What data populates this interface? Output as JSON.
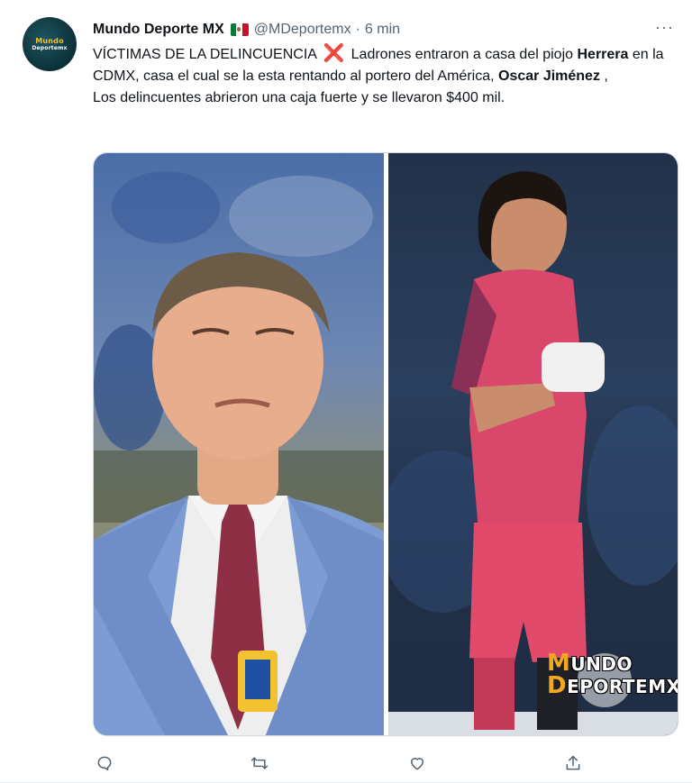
{
  "tweet": {
    "author_name": "Mundo Deporte MX",
    "author_handle": "@MDeportemx",
    "separator": "·",
    "time": "6 min",
    "more_label": "···",
    "avatar_logo": {
      "line1": "Mundo",
      "line2": "Deportemx"
    },
    "text": {
      "p1": "VÍCTIMAS DE LA DELINCUENCIA",
      "p2": " Ladrones entraron a casa del piojo ",
      "p3": "Herrera",
      "p4": " en la CDMX, casa el cual se la esta rentando al portero del América, ",
      "p5": "Oscar Jiménez",
      "p6": ",",
      "p7": "Los delincuentes abrieron una caja fuerte y se llevaron $400 mil."
    },
    "cross_emoji": "❌",
    "watermark": {
      "m": "M",
      "undo": "UNDO",
      "d": "D",
      "eportemx": "EPORTEMX"
    }
  },
  "icons": {
    "verified_flag": "mexico-flag-icon",
    "reply": "reply-icon",
    "retweet": "retweet-icon",
    "like": "heart-icon",
    "share": "share-icon"
  },
  "colors": {
    "text": "#0f1419",
    "secondary": "#536471",
    "accent_cross": "#e0245e",
    "watermark_gold": "#f2a81d"
  }
}
